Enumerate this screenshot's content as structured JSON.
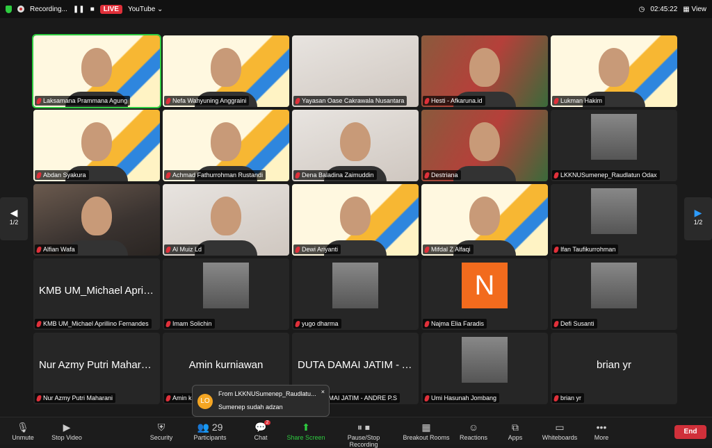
{
  "topbar": {
    "recording": "Recording...",
    "live": "LIVE",
    "stream": "YouTube",
    "chevron": "⌄",
    "clock": "02:45:22",
    "view": "View"
  },
  "nav": {
    "page": "1/2",
    "prev": "◀",
    "next": "▶"
  },
  "tiles": [
    {
      "name": "Laksamana Prammana Agung",
      "kind": "banner",
      "active": true
    },
    {
      "name": "Nefa Wahyuning Anggraini",
      "kind": "banner"
    },
    {
      "name": "Yayasan Oase Cakrawala Nusantara",
      "kind": "light",
      "noface": true
    },
    {
      "name": "Hesti - Afkaruna.id",
      "kind": "room"
    },
    {
      "name": "Lukman Hakim",
      "kind": "banner"
    },
    {
      "name": "Abdan Syakura",
      "kind": "banner"
    },
    {
      "name": "Achmad Fathurrohman Rustandi",
      "kind": "banner"
    },
    {
      "name": "Dena Baladina Zaimuddin",
      "kind": "light"
    },
    {
      "name": "Destriana",
      "kind": "room"
    },
    {
      "name": "LKKNUSumenep_Raudlatun Odax",
      "kind": "pic"
    },
    {
      "name": "Alfian Wafa",
      "kind": "photo"
    },
    {
      "name": "Al Muiz Ld",
      "kind": "light"
    },
    {
      "name": "Dewi Ariyanti",
      "kind": "banner"
    },
    {
      "name": "Mifdal Z Alfaqi",
      "kind": "banner"
    },
    {
      "name": "Ifan Taufikurrohman",
      "kind": "pic"
    },
    {
      "name": "KMB UM_Michael Aprillino Fernandes",
      "kind": "name",
      "big": "KMB UM_Michael Aprilli..."
    },
    {
      "name": "Imam Solichin",
      "kind": "pic"
    },
    {
      "name": "yugo dharma",
      "kind": "pic"
    },
    {
      "name": "Najma Elia Faradis",
      "kind": "letter",
      "letter": "N"
    },
    {
      "name": "Defi Susanti",
      "kind": "pic"
    },
    {
      "name": "Nur Azmy Putri Maharani",
      "kind": "name",
      "big": "Nur Azmy Putri Maharani"
    },
    {
      "name": "Amin kurniawan",
      "kind": "name",
      "big": "Amin kurniawan"
    },
    {
      "name": "DUTA DAMAI JATIM - ANDRE P.S",
      "kind": "name",
      "big": "DUTA DAMAI JATIM - A..."
    },
    {
      "name": "Umi Hasunah Jombang",
      "kind": "pic"
    },
    {
      "name": "brian yr",
      "kind": "name",
      "big": "brian yr"
    }
  ],
  "toast": {
    "initials": "LO",
    "from": "From LKKNUSumenep_Raudlatu...",
    "message": "Sumenep sudah adzan",
    "close": "×"
  },
  "toolbar": [
    {
      "label": "Unmute",
      "icon": "🎙",
      "name": "unmute"
    },
    {
      "label": "Stop Video",
      "icon": "▶",
      "name": "stop-video"
    },
    {
      "label": "Security",
      "icon": "⛨",
      "name": "security"
    },
    {
      "label": "Participants",
      "icon": "👥 29",
      "name": "participants"
    },
    {
      "label": "Chat",
      "icon": "💬",
      "name": "chat",
      "badge": "2"
    },
    {
      "label": "Share Screen",
      "icon": "⬆",
      "name": "share-screen",
      "green": true
    },
    {
      "label": "Pause/Stop Recording",
      "icon": "⏸ ⏹",
      "name": "pause-stop-recording"
    },
    {
      "label": "Breakout Rooms",
      "icon": "▦",
      "name": "breakout-rooms"
    },
    {
      "label": "Reactions",
      "icon": "☺",
      "name": "reactions"
    },
    {
      "label": "Apps",
      "icon": "⧉",
      "name": "apps"
    },
    {
      "label": "Whiteboards",
      "icon": "▭",
      "name": "whiteboards"
    },
    {
      "label": "More",
      "icon": "•••",
      "name": "more"
    }
  ],
  "end_label": "End"
}
